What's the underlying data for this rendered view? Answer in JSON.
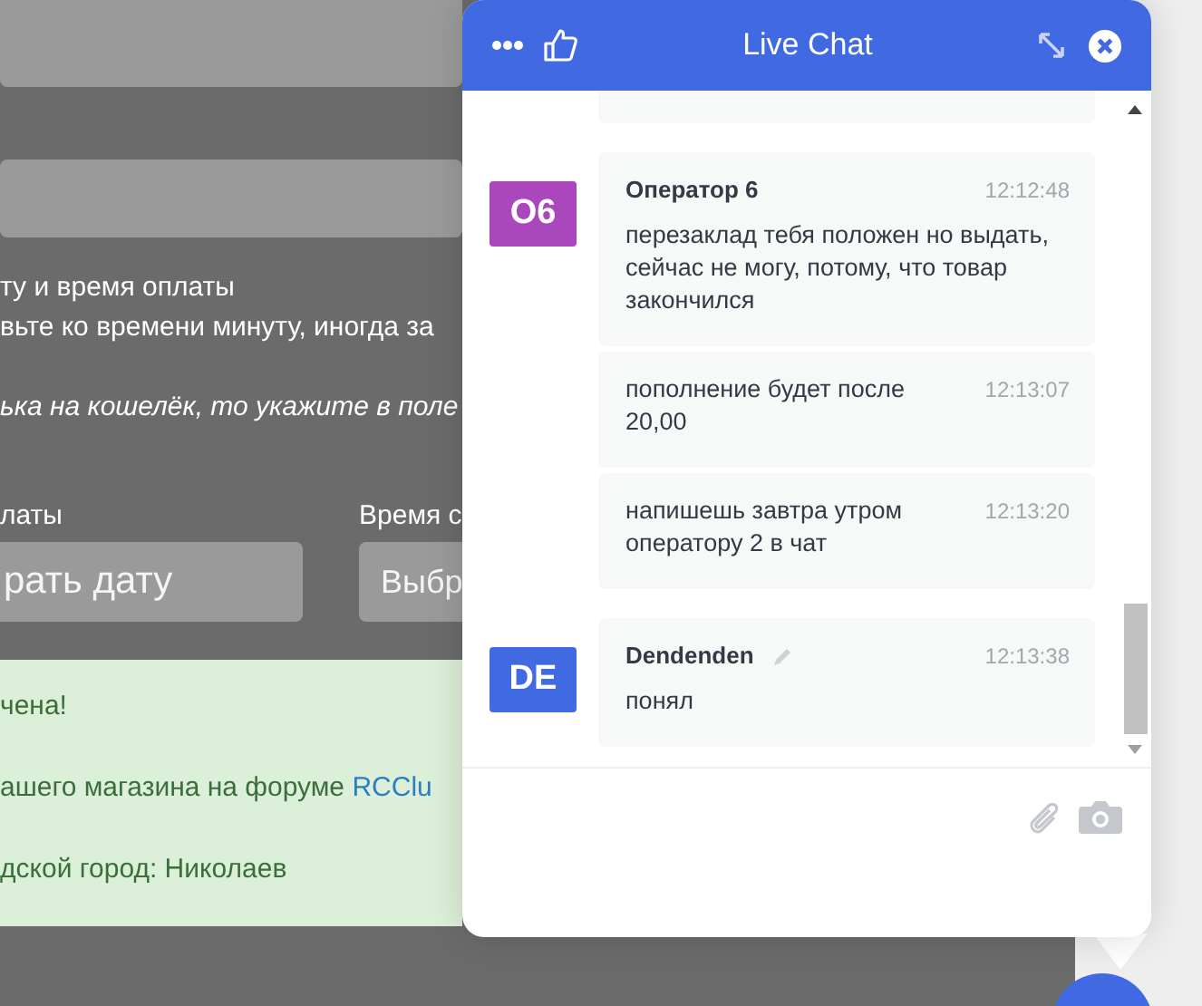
{
  "page": {
    "instructions": [
      {
        "kind": "plain",
        "text": "ту и время оплаты"
      },
      {
        "kind": "plain",
        "text": "вьте ко времени минуту, иногда за"
      },
      {
        "kind": "italic",
        "text": "ька на кошелёк, то укажите в поле"
      }
    ],
    "date_field": {
      "label": "латы",
      "placeholder": "рать дату"
    },
    "time_field": {
      "label": "Время с",
      "placeholder": "Выбр"
    },
    "notice": [
      {
        "text": "чена!"
      },
      {
        "text": "ашего магазина на форуме",
        "link": "RCClu"
      },
      {
        "text": "дской город: Николаев"
      }
    ]
  },
  "chat": {
    "title": "Live Chat",
    "groups": [
      {
        "author": "Оператор 6",
        "initials": "О6",
        "color": "#ab47bc",
        "editable": false,
        "entries": [
          {
            "text": "перезаклад тебя положен но выдать, сейчас не могу, потому, что товар закончился",
            "time": "12:12:48"
          },
          {
            "text": "пополнение будет после 20,00",
            "time": "12:13:07"
          },
          {
            "text": "напишешь завтра утром оператору 2 в чат",
            "time": "12:13:20"
          }
        ]
      },
      {
        "author": "Dendenden",
        "initials": "DE",
        "color": "#4169e1",
        "editable": true,
        "entries": [
          {
            "text": "понял",
            "time": "12:13:38"
          }
        ]
      }
    ]
  }
}
